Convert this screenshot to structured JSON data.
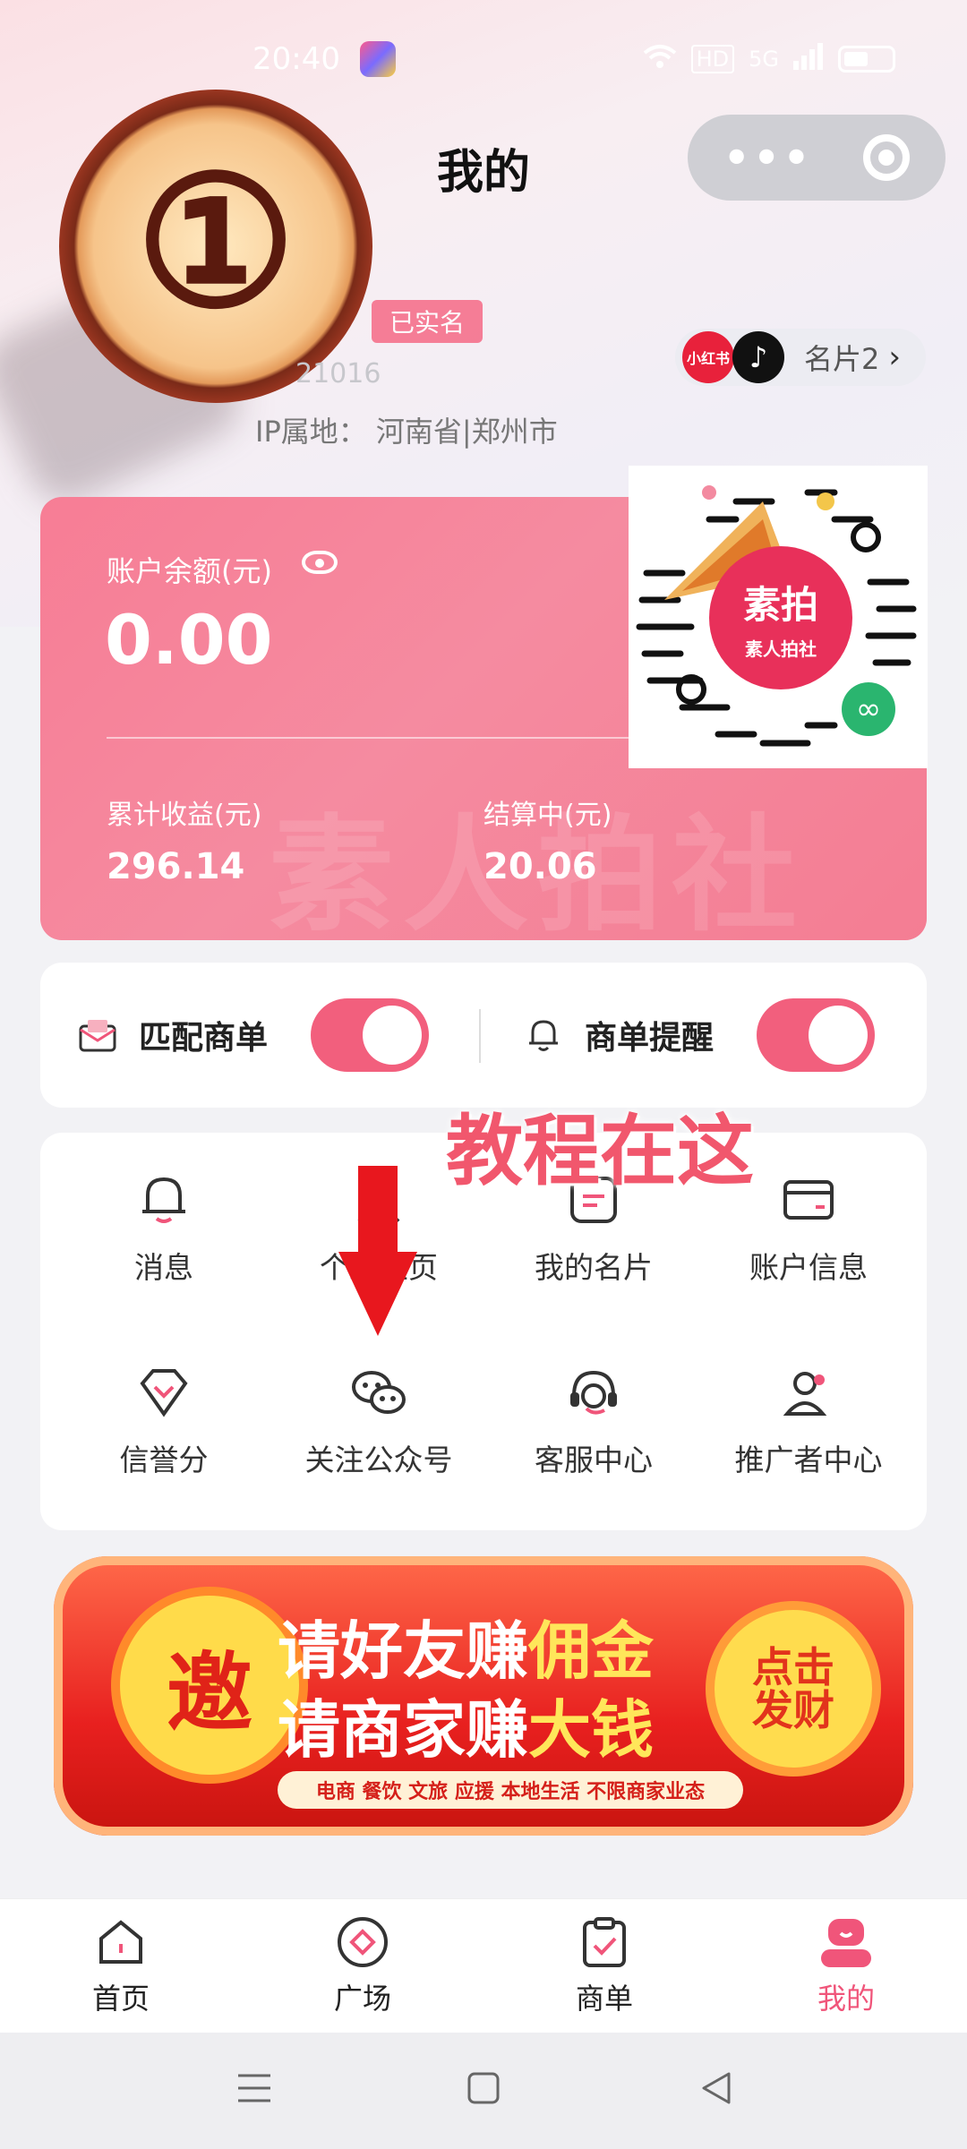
{
  "status": {
    "time": "20:40",
    "network": "5G",
    "hd": "HD"
  },
  "header": {
    "title": "我的"
  },
  "overlay": {
    "step_number": "①",
    "tutorial_text": "教程在这"
  },
  "profile": {
    "verified_badge": "已实名",
    "user_id_partial": "21016",
    "ip_label": "IP属地：",
    "ip_location": "河南省|郑州市"
  },
  "namecard": {
    "xhs": "小红书",
    "label": "名片2",
    "chevron": "›"
  },
  "account_card": {
    "balance_label": "账户余额(元)",
    "balance": "0.00",
    "total_label": "累计收益(元)",
    "total": "296.14",
    "settling_label": "结算中(元)",
    "settling": "20.06",
    "watermark": "素人拍社"
  },
  "qr": {
    "title": "素拍",
    "subtitle": "素人拍社"
  },
  "toggles": [
    {
      "label": "匹配商单",
      "on": true
    },
    {
      "label": "商单提醒",
      "on": true
    }
  ],
  "menu": [
    {
      "label": "消息",
      "icon": "bell-icon"
    },
    {
      "label": "个人主页",
      "icon": "profile-icon"
    },
    {
      "label": "我的名片",
      "icon": "card-icon"
    },
    {
      "label": "账户信息",
      "icon": "wallet-icon"
    },
    {
      "label": "信誉分",
      "icon": "diamond-icon"
    },
    {
      "label": "关注公众号",
      "icon": "wechat-icon"
    },
    {
      "label": "客服中心",
      "icon": "headset-icon"
    },
    {
      "label": "推广者中心",
      "icon": "promoter-icon"
    }
  ],
  "banner": {
    "badge": "邀",
    "line1_a": "请好友赚",
    "line1_b": "佣金",
    "line2_a": "请商家赚",
    "line2_b": "大钱",
    "tags": "电商 餐饮 文旅 应援 本地生活 不限商家业态",
    "cta_1": "点击",
    "cta_2": "发财"
  },
  "tabs": [
    {
      "label": "首页",
      "icon": "home-icon",
      "active": false
    },
    {
      "label": "广场",
      "icon": "plaza-icon",
      "active": false
    },
    {
      "label": "商单",
      "icon": "order-icon",
      "active": false
    },
    {
      "label": "我的",
      "icon": "me-icon",
      "active": true
    }
  ],
  "colors": {
    "accent": "#f0557a",
    "card": "#f58ba0",
    "switch": "#f25f7d"
  }
}
